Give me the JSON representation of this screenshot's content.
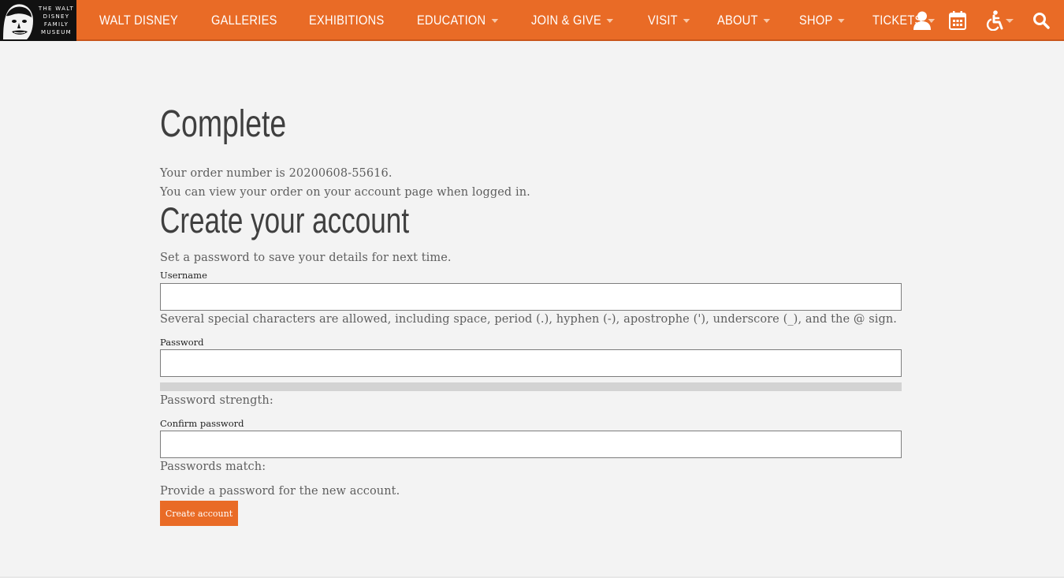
{
  "header": {
    "logo": {
      "lines": [
        "THE WALT",
        "DISNEY",
        "FAMILY",
        "MUSEUM"
      ]
    },
    "nav": [
      {
        "label": "WALT DISNEY",
        "dropdown": false
      },
      {
        "label": "GALLERIES",
        "dropdown": false
      },
      {
        "label": "EXHIBITIONS",
        "dropdown": false
      },
      {
        "label": "EDUCATION",
        "dropdown": true
      },
      {
        "label": "JOIN & GIVE",
        "dropdown": true
      },
      {
        "label": "VISIT",
        "dropdown": true
      },
      {
        "label": "ABOUT",
        "dropdown": true
      },
      {
        "label": "SHOP",
        "dropdown": true
      },
      {
        "label": "TICKETS",
        "dropdown": true
      }
    ],
    "utilities": [
      "user-icon",
      "calendar-icon",
      "accessibility-icon",
      "search-icon"
    ],
    "colors": {
      "bar": "#e96b26",
      "logo_bg": "#111111"
    }
  },
  "main": {
    "complete_title": "Complete",
    "order_number_text": "Your order number is 20200608-55616.",
    "order_view_text": "You can view your order on your account page when logged in.",
    "create_title": "Create your account",
    "intro_text": "Set a password to save your details for next time.",
    "username": {
      "label": "Username",
      "value": "",
      "help": "Several special characters are allowed, including space, period (.), hyphen (-), apostrophe ('), underscore (_), and the @ sign."
    },
    "password": {
      "label": "Password",
      "value": "",
      "strength_label": "Password strength:",
      "strength_value": 0
    },
    "confirm_password": {
      "label": "Confirm password",
      "value": "",
      "match_label": "Passwords match:"
    },
    "hint_text": "Provide a password for the new account.",
    "submit_label": "Create account",
    "accent_color": "#e96b26"
  }
}
